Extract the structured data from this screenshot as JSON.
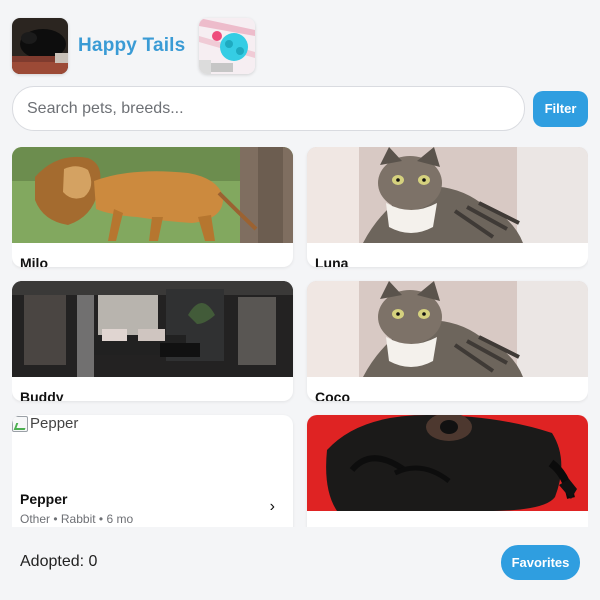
{
  "header": {
    "brand": "Happy Tails",
    "thumb_left_icon": "cat-sleeping-icon",
    "thumb_right_icon": "pet-toy-icon"
  },
  "search": {
    "placeholder": "Search pets, breeds...",
    "value": "",
    "filter_label": "Filter"
  },
  "cards": [
    {
      "name": "Milo",
      "icon": "lion-image"
    },
    {
      "name": "Luna",
      "icon": "tabby-cat-image"
    },
    {
      "name": "Buddy",
      "icon": "living-room-image"
    },
    {
      "name": "Coco",
      "icon": "tabby-cat-image"
    },
    {
      "name": "Pepper",
      "alt": "Pepper",
      "meta": "Other • Rabbit • 6 mo",
      "chevron": "›"
    },
    {
      "name": "",
      "icon": "pug-image"
    }
  ],
  "footer": {
    "adopted": "Adopted: 0",
    "favorites_label": "Favorites"
  },
  "colors": {
    "accent": "#2f9ee0",
    "brand_text": "#3a9bd5",
    "background": "#f4f5f7",
    "card": "#ffffff"
  }
}
